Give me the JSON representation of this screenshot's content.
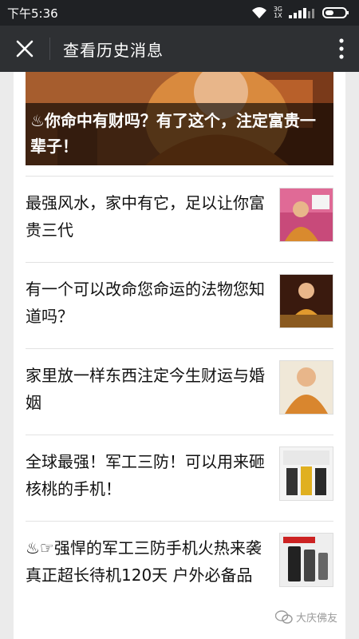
{
  "status_bar": {
    "time": "下午5:36",
    "network_top": "3G",
    "network_bottom": "1X"
  },
  "nav": {
    "title": "查看历史消息"
  },
  "hero": {
    "title": "♨你命中有财吗？有了这个，注定富贵一辈子！"
  },
  "items": [
    {
      "title": " 最强风水，家中有它，足以让你富贵三代"
    },
    {
      "title": " 有一个可以改命您命运的法物您知道吗？"
    },
    {
      "title": " 家里放一样东西注定今生财运与婚姻"
    },
    {
      "title": "全球最强！军工三防！可以用来砸核桃的手机！"
    },
    {
      "title": "♨☞强悍的军工三防手机火热来袭 真正超长待机120天 户外必备品"
    }
  ],
  "watermark": {
    "text": "大庆佛友"
  },
  "colors": {
    "status_bg": "#1f2124",
    "nav_bg": "#2e3033",
    "page_bg": "#ebebeb",
    "card_bg": "#ffffff"
  }
}
